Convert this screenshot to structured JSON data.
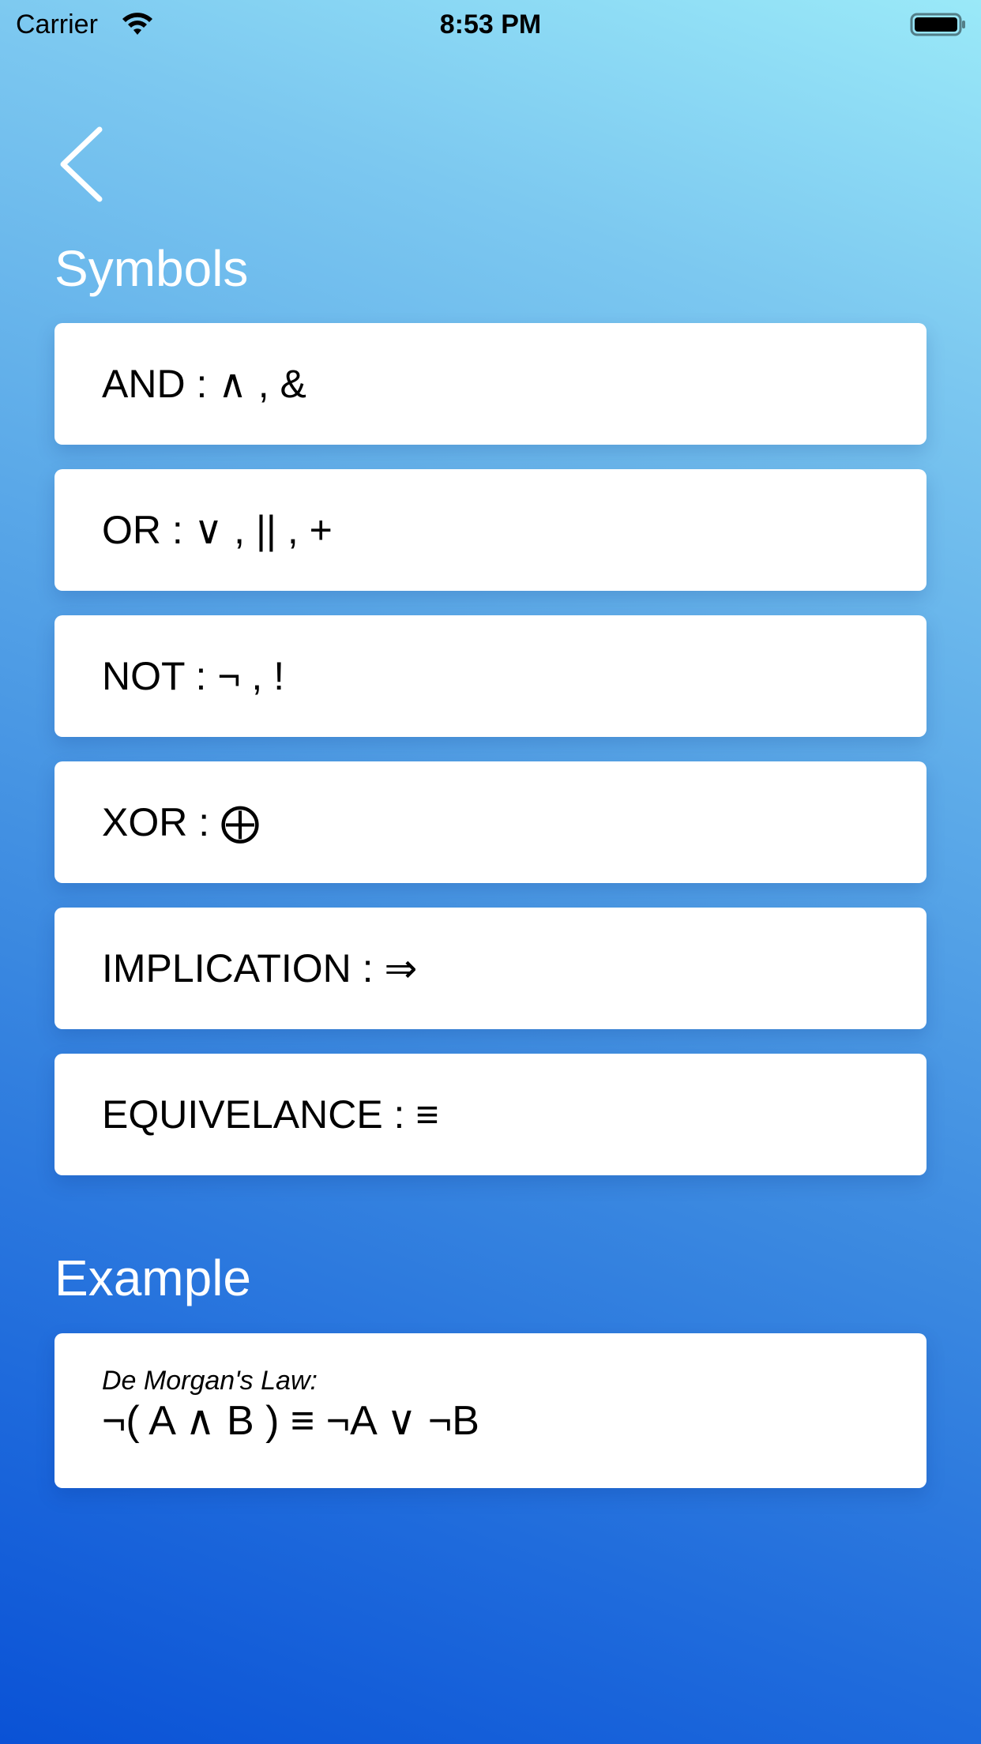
{
  "status_bar": {
    "carrier": "Carrier",
    "time": "8:53 PM"
  },
  "sections": {
    "symbols_title": "Symbols",
    "example_title": "Example"
  },
  "symbols": [
    {
      "text": "AND : ∧ , &"
    },
    {
      "text": "OR : ∨ , || , +"
    },
    {
      "text": "NOT : ¬ , !"
    },
    {
      "text": "XOR : ⨁"
    },
    {
      "text": "IMPLICATION : ⇒"
    },
    {
      "text": "EQUIVELANCE : ≡"
    }
  ],
  "example": {
    "label": "De Morgan's Law:",
    "formula": "¬( A ∧ B ) ≡ ¬A ∨ ¬B"
  },
  "icons": {
    "back": "chevron-left-icon",
    "wifi": "wifi-icon",
    "battery": "battery-icon"
  },
  "colors": {
    "background_top": "#9ae9f8",
    "background_bottom": "#0a52d6",
    "card": "#ffffff",
    "title_text": "#ffffff"
  }
}
